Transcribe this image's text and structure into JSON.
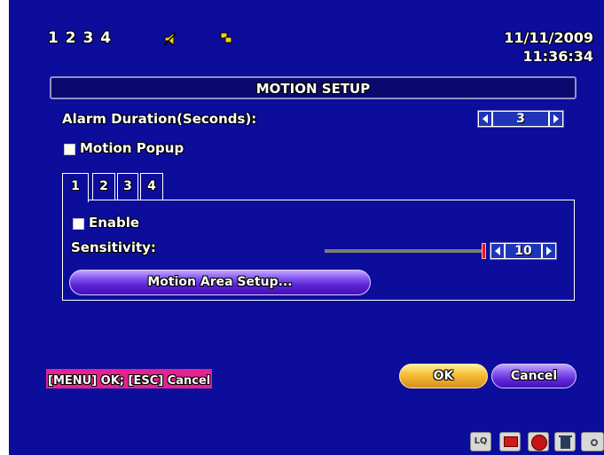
{
  "header": {
    "channels": "1 2 3 4",
    "date": "11/11/2009",
    "time": "11:36:34"
  },
  "dialog": {
    "title": "MOTION SETUP",
    "alarm_duration_label": "Alarm Duration(Seconds):",
    "alarm_duration_value": "3",
    "motion_popup_label": "Motion Popup",
    "motion_popup_checked": false,
    "tabs": [
      {
        "label": "1",
        "active": true
      },
      {
        "label": "2",
        "active": false
      },
      {
        "label": "3",
        "active": false
      },
      {
        "label": "4",
        "active": false
      }
    ],
    "enable_label": "Enable",
    "enable_checked": false,
    "sensitivity_label": "Sensitivity:",
    "sensitivity_value": "10",
    "motion_area_button_label": "Motion Area Setup...",
    "hint": "[MENU] OK; [ESC] Cancel",
    "ok_label": "OK",
    "cancel_label": "Cancel"
  },
  "status_bar": {
    "quality_label": "LQ",
    "icons": [
      "lq-quality-icon",
      "monitor-icon",
      "record-icon",
      "trash-icon",
      "camera-icon"
    ]
  },
  "colors": {
    "background": "#0d0d9c",
    "hint_bg": "#e3238f",
    "ok_button": "#f6c23a",
    "cancel_button": "#5b24d6",
    "slider_thumb": "#e01c1c"
  }
}
